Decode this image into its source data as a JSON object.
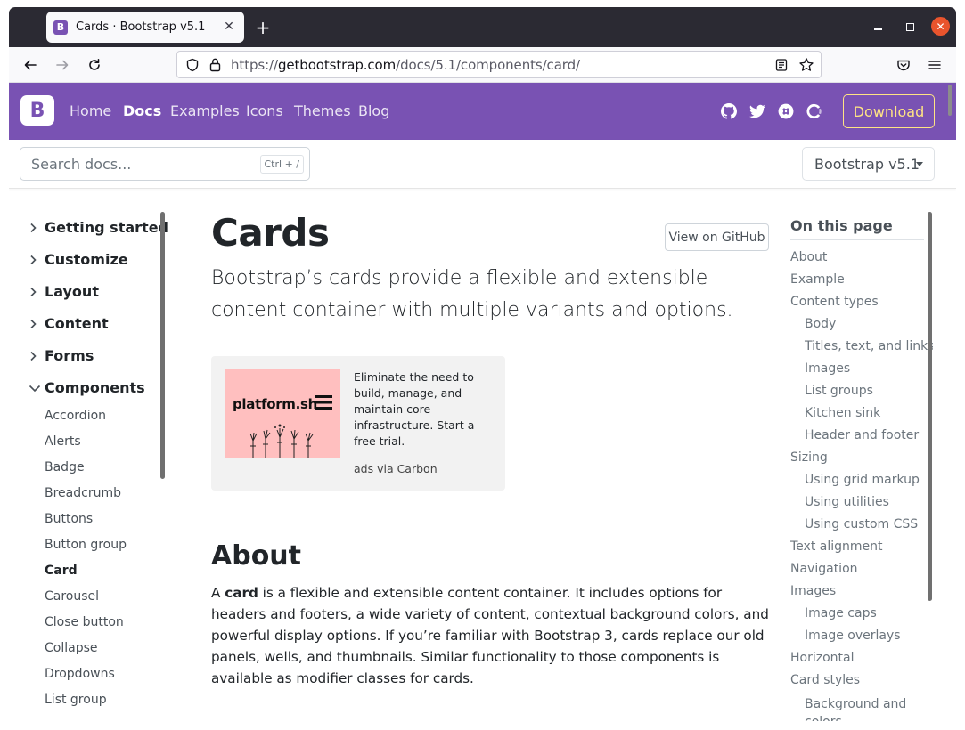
{
  "browser": {
    "tab_title": "Cards · Bootstrap v5.1",
    "tab_favicon_letter": "B",
    "url_prefix": "https://",
    "url_domain": "getbootstrap.com",
    "url_path": "/docs/5.1/components/card/"
  },
  "site": {
    "logo_letter": "B",
    "nav": [
      "Home",
      "Docs",
      "Examples",
      "Icons",
      "Themes",
      "Blog"
    ],
    "active_nav": "Docs",
    "download_label": "Download",
    "search_placeholder": "Search docs...",
    "search_shortcut": "Ctrl + /",
    "version_label": "Bootstrap v5.1",
    "brand_color": "#7952b3",
    "accent_color": "#ffe484"
  },
  "sidebar": {
    "groups": [
      "Getting started",
      "Customize",
      "Layout",
      "Content",
      "Forms",
      "Components"
    ],
    "component_links": [
      "Accordion",
      "Alerts",
      "Badge",
      "Breadcrumb",
      "Buttons",
      "Button group",
      "Card",
      "Carousel",
      "Close button",
      "Collapse",
      "Dropdowns",
      "List group"
    ],
    "active_link": "Card"
  },
  "main": {
    "title": "Cards",
    "github_button": "View on GitHub",
    "lead": "Bootstrap’s cards provide a flexible and extensible content container with multiple variants and options.",
    "ad_logo_text": "platform.sh",
    "ad_text": "Eliminate the need to build, manage, and maintain core infrastructure. Start a free trial.",
    "ad_poweredby": "ads via Carbon",
    "about_heading": "About",
    "about_p_start": "A ",
    "about_p_bold": "card",
    "about_p_rest": " is a flexible and extensible content container. It includes options for headers and footers, a wide variety of content, contextual background colors, and powerful display options. If you’re familiar with Bootstrap 3, cards replace our old panels, wells, and thumbnails. Similar functionality to those components is available as modifier classes for cards."
  },
  "toc": {
    "title": "On this page",
    "items": [
      {
        "label": "About",
        "level": 1
      },
      {
        "label": "Example",
        "level": 1
      },
      {
        "label": "Content types",
        "level": 1
      },
      {
        "label": "Body",
        "level": 2
      },
      {
        "label": "Titles, text, and links",
        "level": 2
      },
      {
        "label": "Images",
        "level": 2
      },
      {
        "label": "List groups",
        "level": 2
      },
      {
        "label": "Kitchen sink",
        "level": 2
      },
      {
        "label": "Header and footer",
        "level": 2
      },
      {
        "label": "Sizing",
        "level": 1
      },
      {
        "label": "Using grid markup",
        "level": 2
      },
      {
        "label": "Using utilities",
        "level": 2
      },
      {
        "label": "Using custom CSS",
        "level": 2
      },
      {
        "label": "Text alignment",
        "level": 1
      },
      {
        "label": "Navigation",
        "level": 1
      },
      {
        "label": "Images",
        "level": 1
      },
      {
        "label": "Image caps",
        "level": 2
      },
      {
        "label": "Image overlays",
        "level": 2
      },
      {
        "label": "Horizontal",
        "level": 1
      },
      {
        "label": "Card styles",
        "level": 1
      },
      {
        "label": "Background and colors",
        "level": 2
      }
    ]
  }
}
